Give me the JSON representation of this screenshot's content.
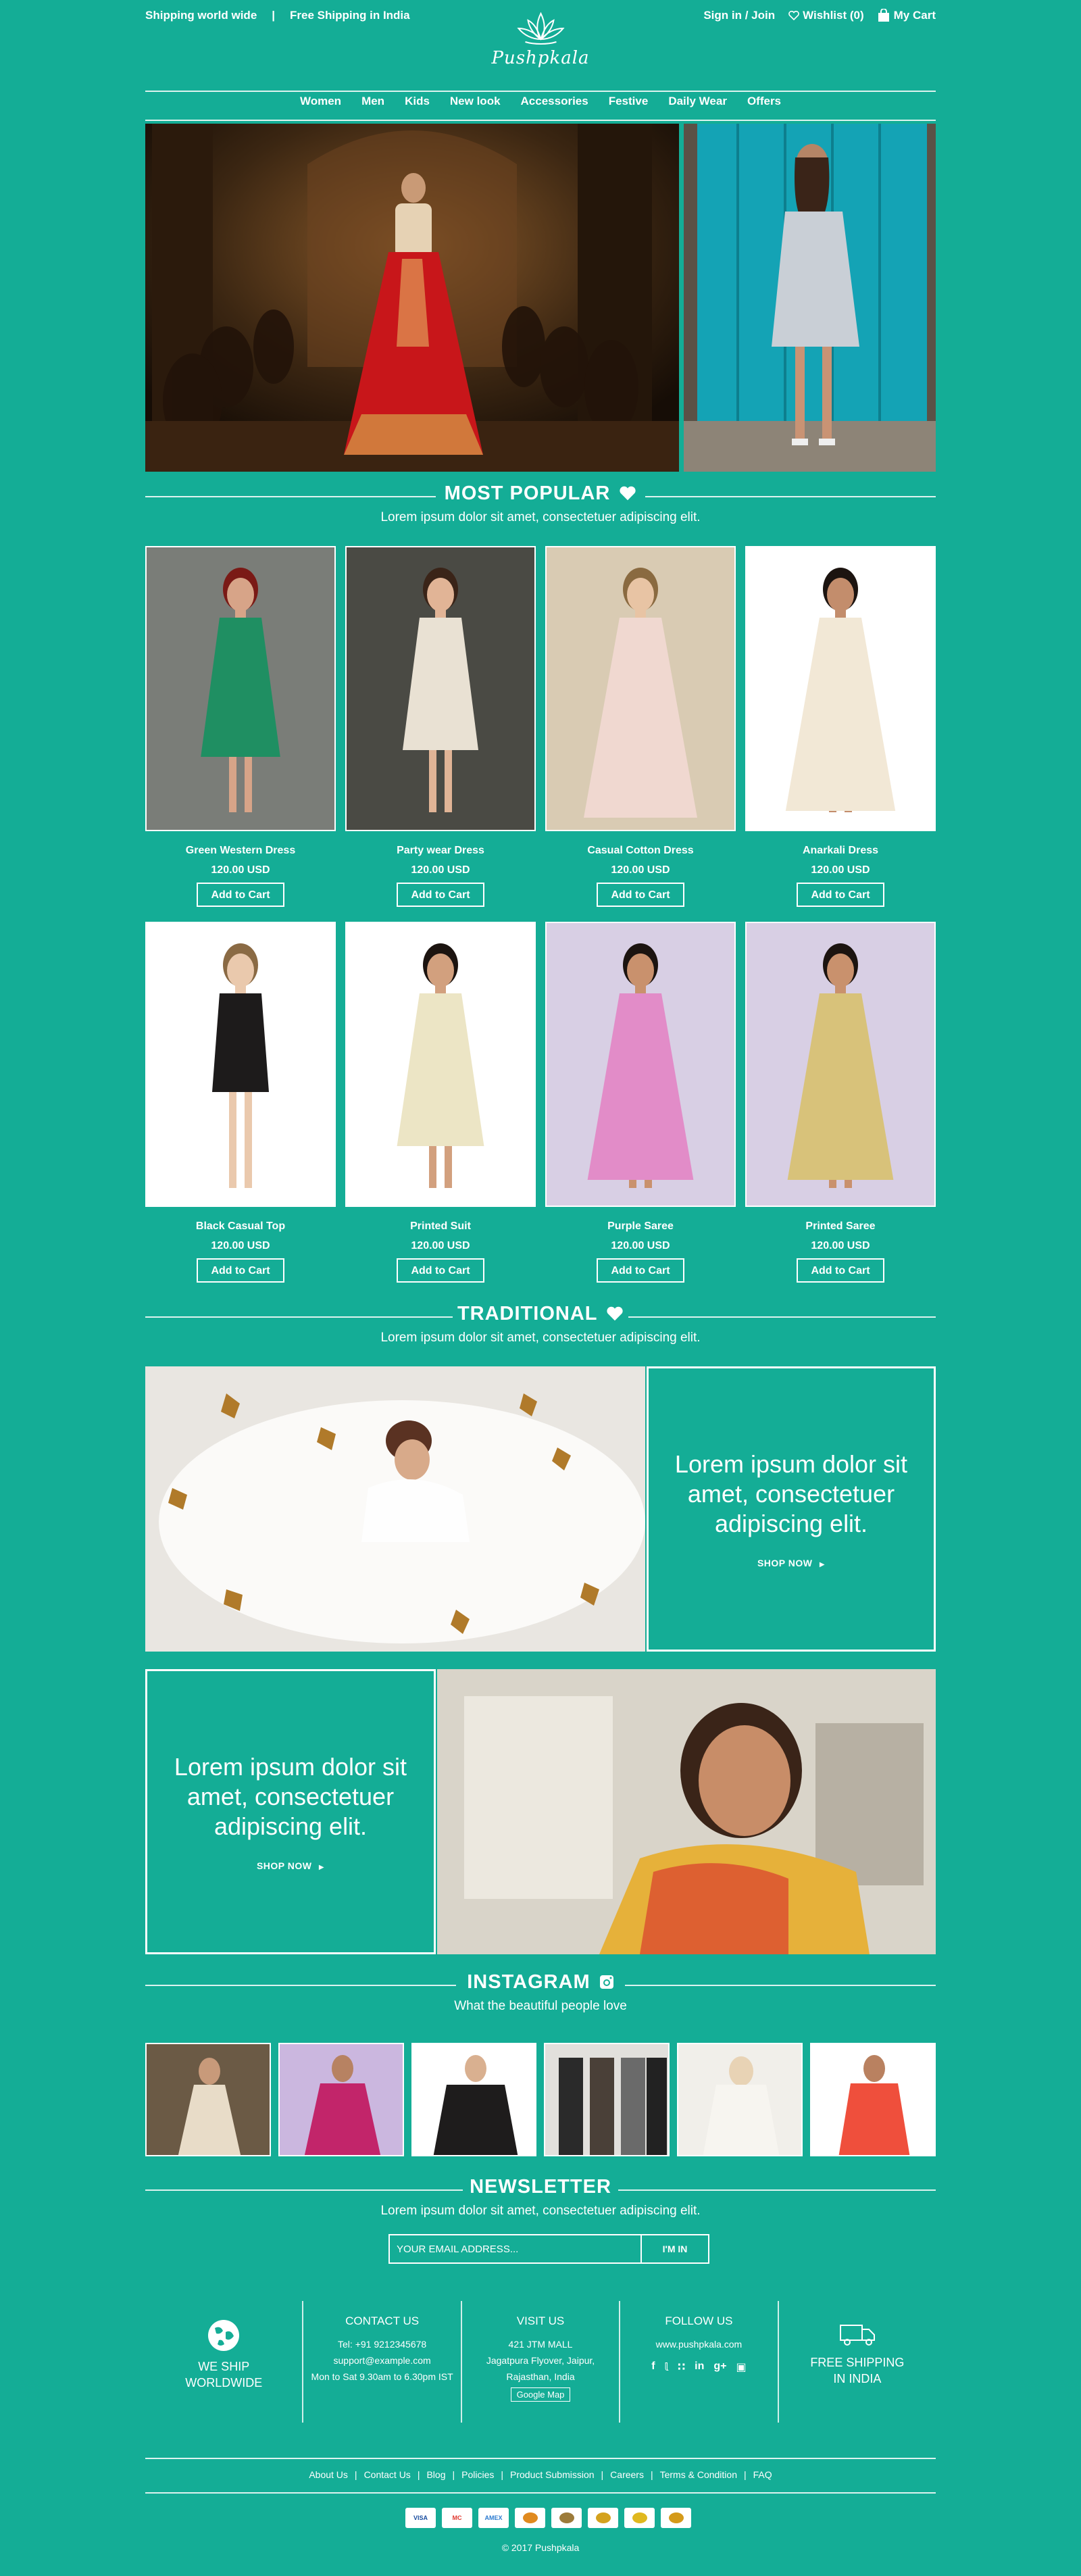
{
  "header": {
    "shipping_world": "Shipping world wide",
    "separator": "|",
    "free_shipping": "Free Shipping in India",
    "brand": "Pushpkala",
    "sign_in": "Sign in / Join",
    "wishlist": "Wishlist (0)",
    "cart": "My Cart"
  },
  "nav": [
    "Women",
    "Men",
    "Kids",
    "New look",
    "Accessories",
    "Festive",
    "Daily Wear",
    "Offers"
  ],
  "most_popular": {
    "title": "MOST POPULAR",
    "subtitle": "Lorem ipsum dolor sit amet, consectetuer adipiscing elit."
  },
  "products": [
    {
      "name": "Green Western Dress",
      "price": "120.00 USD",
      "button": "Add to Cart"
    },
    {
      "name": "Party wear Dress",
      "price": "120.00 USD",
      "button": "Add to Cart"
    },
    {
      "name": "Casual Cotton Dress",
      "price": "120.00 USD",
      "button": "Add to Cart"
    },
    {
      "name": "Anarkali Dress",
      "price": "120.00 USD",
      "button": "Add to Cart"
    },
    {
      "name": "Black Casual Top",
      "price": "120.00 USD",
      "button": "Add to Cart"
    },
    {
      "name": "Printed Suit",
      "price": "120.00 USD",
      "button": "Add to Cart"
    },
    {
      "name": "Purple Saree",
      "price": "120.00 USD",
      "button": "Add to Cart"
    },
    {
      "name": "Printed Saree",
      "price": "120.00 USD",
      "button": "Add to Cart"
    }
  ],
  "traditional": {
    "title": "TRADITIONAL",
    "subtitle": "Lorem ipsum dolor sit amet, consectetuer adipiscing elit.",
    "banner1_text": "Lorem ipsum dolor sit amet, consectetuer adipiscing elit.",
    "banner1_cta": "SHOP NOW",
    "banner2_text": "Lorem ipsum dolor sit amet, consectetuer adipiscing elit.",
    "banner2_cta": "SHOP NOW"
  },
  "instagram": {
    "title": "INSTAGRAM",
    "subtitle": "What the beautiful people love"
  },
  "newsletter": {
    "title": "NEWSLETTER",
    "subtitle": "Lorem ipsum dolor sit amet, consectetuer adipiscing elit.",
    "placeholder": "YOUR EMAIL ADDRESS...",
    "button": "I'M IN"
  },
  "footer": {
    "ship_l1": "WE SHIP",
    "ship_l2": "WORLDWIDE",
    "contact_title": "CONTACT US",
    "contact_tel": "Tel: +91 9212345678",
    "contact_email": "support@example.com",
    "contact_hours": "Mon to Sat 9.30am to 6.30pm IST",
    "visit_title": "VISIT US",
    "visit_l1": "421 JTM MALL",
    "visit_l2": "Jagatpura Flyover, Jaipur,",
    "visit_l3": "Rajasthan, India",
    "visit_map": "Google Map",
    "follow_title": "FOLLOW US",
    "follow_site": "www.pushpkala.com",
    "free_l1": "FREE SHIPPING",
    "free_l2": "IN INDIA",
    "links": [
      "About Us",
      "Contact Us",
      "Blog",
      "Policies",
      "Product Submission",
      "Careers",
      "Terms & Condition",
      "FAQ"
    ],
    "payment": [
      "VISA",
      "MC",
      "AMEX",
      "",
      "",
      "",
      "",
      ""
    ],
    "copyright": "© 2017  Pushpkala"
  }
}
